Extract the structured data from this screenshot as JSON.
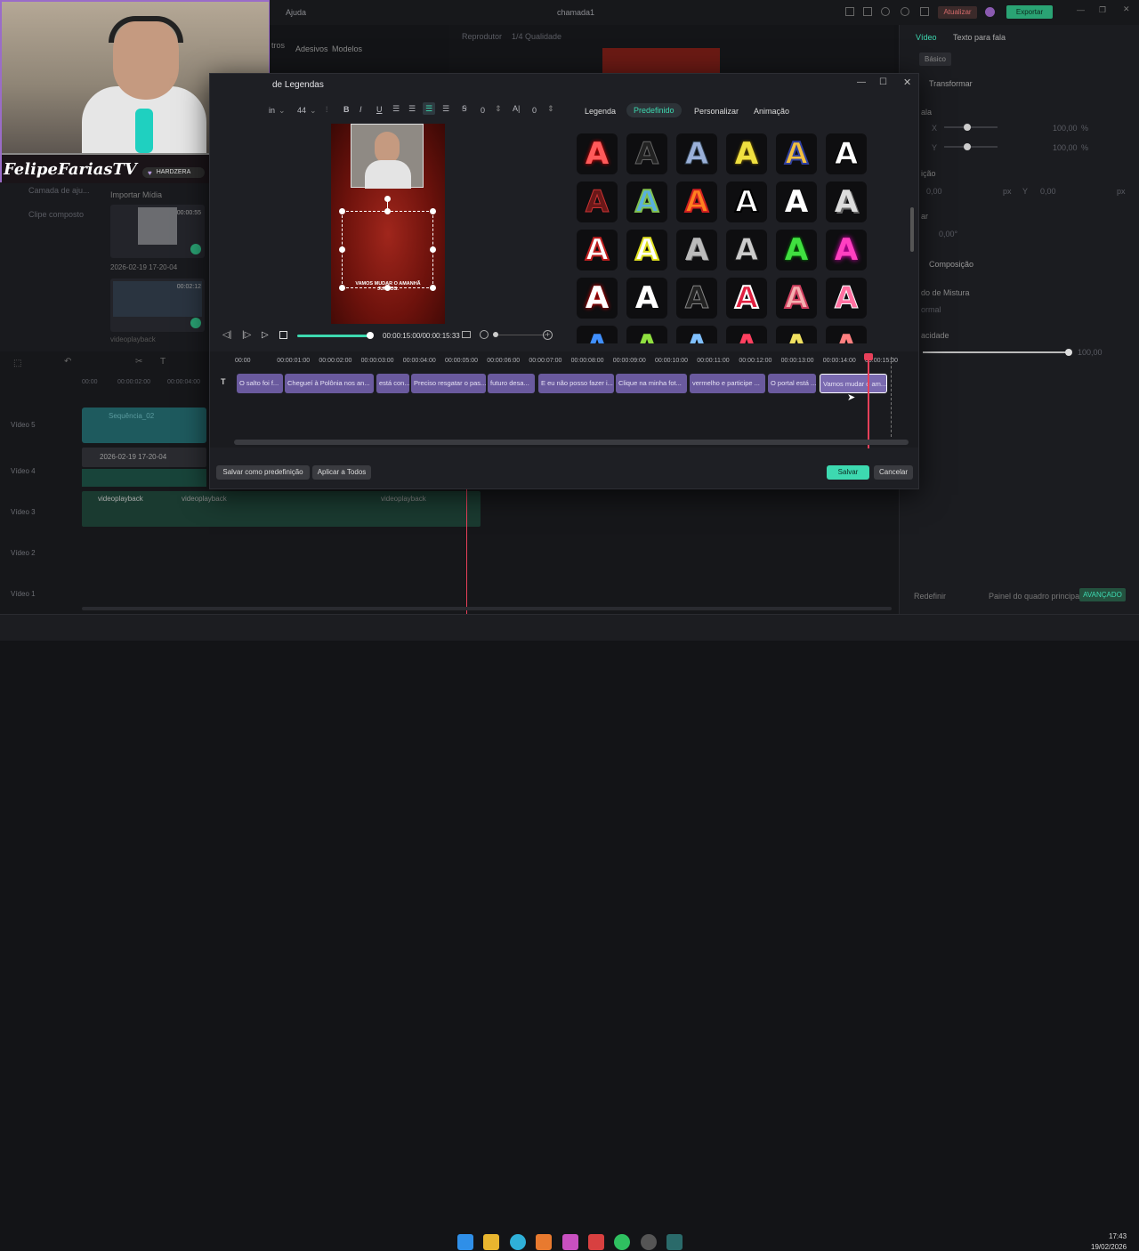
{
  "app": {
    "menu_ajuda": "Ajuda",
    "project_name": "chamada1",
    "upgrade": "Atualizar",
    "export": "Exportar"
  },
  "left": {
    "tab_adesivos": "Adesivos",
    "tab_modelos": "Modelos",
    "tab_ltros": "tros",
    "camada": "Camada de aju...",
    "clipe": "Clipe composto",
    "import": "Importar Mídia",
    "media1_dur": "00:00:55",
    "media1_name": "2026-02-19 17-20-04",
    "media2_dur": "00:02:12",
    "media3_name": "videoplayback"
  },
  "right": {
    "tab_video": "Vídeo",
    "tab_tts": "Texto para fala",
    "basic": "Básico",
    "transform": "Transformar",
    "escala": "ala",
    "pos": "ição",
    "rot": "ar",
    "x_label": "X",
    "y_label": "Y",
    "scale_x": "100,00",
    "scale_y": "100,00",
    "pct": "%",
    "pos_x": "0,00",
    "pos_y": "0,00",
    "px": "px",
    "rot_val": "0,00°",
    "composition": "Composição",
    "blend": "do de Mistura",
    "blend_val": "ormal",
    "opacity": "acidade",
    "opacity_val": "100,00",
    "reset": "Redefinir",
    "keyframe": "Painel do quadro principal",
    "advanced": "AVANÇADO"
  },
  "preview_top": {
    "player": "Reprodutor",
    "quality": "1/4 Qualidade"
  },
  "streamer": {
    "name": "FelipeFariasTV",
    "badge": "HARDZERA"
  },
  "dialog": {
    "title": "de Legendas",
    "font_partial": "in",
    "font_size": "44",
    "spacing1": "0",
    "spacing2": "0",
    "caption_text": "VAMOS MUDAR O AMANHÃ JUNTOS.",
    "time": "00:00:15:00/00:00:15:33",
    "tabs": [
      "Legenda",
      "Predefinido",
      "Personalizar",
      "Animação"
    ],
    "ruler": [
      "00:00",
      "00:00:01:00",
      "00:00:02:00",
      "00:00:03:00",
      "00:00:04:00",
      "00:00:05:00",
      "00:00:06:00",
      "00:00:07:00",
      "00:00:08:00",
      "00:00:09:00",
      "00:00:10:00",
      "00:00:11:00",
      "00:00:12:00",
      "00:00:13:00",
      "00:00:14:00",
      "00:00:15:00"
    ],
    "clips": [
      "O salto foi f...",
      "Chegueí à Polônia nos an...",
      "está con...",
      "Preciso resgatar o pas...",
      "futuro desa...",
      "E eu não posso fazer i...",
      "Clique na minha fot...",
      "vermelho e participe ...",
      "O portal está ...",
      "Vamos mudar o am..."
    ],
    "btn_save_preset": "Salvar como predefinição",
    "btn_apply_all": "Aplicar a Todos",
    "btn_save": "Salvar",
    "btn_cancel": "Cancelar",
    "preset_letter": "A"
  },
  "timeline": {
    "seq": "Sequência_02",
    "clip_date": "2026-02-19 17-20-04",
    "vp": "videoplayback",
    "t0": "00:00",
    "t1": "00:00:02:00",
    "t2": "00:00:04:00",
    "tracks": [
      "Vídeo 5",
      "Vídeo 4",
      "Vídeo 3",
      "Vídeo 2",
      "Vídeo 1"
    ]
  },
  "taskbar": {
    "time": "17:43",
    "date": "19/02/2026"
  },
  "colors": {
    "accent": "#3dd9b0",
    "clip": "#6a5a9e",
    "playhead": "#e8405a",
    "export": "#2aa374"
  }
}
